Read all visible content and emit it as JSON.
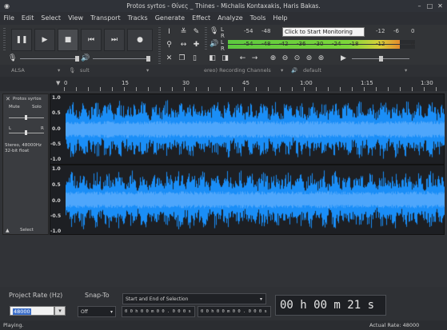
{
  "window": {
    "title": "Protos syrtos - Θίνες _ Thines - Michalis Kontaxakis, Haris Bakas."
  },
  "menu": [
    "File",
    "Edit",
    "Select",
    "View",
    "Transport",
    "Tracks",
    "Generate",
    "Effect",
    "Analyze",
    "Tools",
    "Help"
  ],
  "meters": {
    "tooltip": "Click to Start Monitoring",
    "rec_marks": [
      "-54",
      "-48",
      "",
      "",
      "",
      "",
      "-12",
      "-6",
      "0"
    ],
    "play_marks": [
      "-54",
      "-48",
      "-42",
      "-36",
      "-30",
      "-24",
      "-18",
      "-12",
      "0"
    ],
    "L": "L",
    "R": "R",
    "play_level": 0.92
  },
  "device": {
    "host": "ALSA",
    "mic_icon": "mic-icon",
    "input": "sult",
    "channels": "ereo) Recording Channels",
    "speaker_icon": "speaker-icon",
    "output": "default"
  },
  "ruler": {
    "ticks": [
      "0",
      "15",
      "30",
      "45",
      "1:00",
      "1:15",
      "1:30"
    ]
  },
  "track": {
    "name": "Protos syrtos",
    "mute": "Mute",
    "solo": "Solo",
    "l": "L",
    "r": "R",
    "info1": "Stereo, 48000Hz",
    "info2": "32-bit float",
    "select": "Select",
    "scale": [
      "1.0",
      "0.5",
      "0.0",
      "-0.5",
      "-1.0"
    ],
    "wave_color": "#1a8ef7"
  },
  "bottom": {
    "rate_label": "Project Rate (Hz)",
    "rate_value": "48000",
    "snap_label": "Snap-To",
    "snap_value": "Off",
    "selection_label": "Start and End of Selection",
    "sel_start": "0 0 h 0 0 m 0 0 . 0 0 0 s",
    "sel_end": "0 0 h 0 0 m 0 0 . 0 0 0 s",
    "time": "00 h 00 m 21 s"
  },
  "status": {
    "left": "Playing.",
    "right": "Actual Rate: 48000"
  }
}
